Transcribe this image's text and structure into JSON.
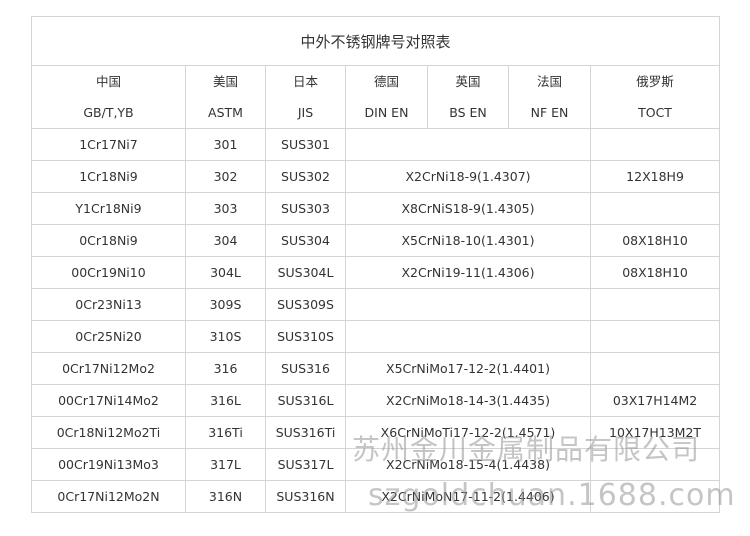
{
  "title": "中外不锈钢牌号对照表",
  "headers": [
    {
      "country": "中国",
      "standard": "GB/T,YB"
    },
    {
      "country": "美国",
      "standard": "ASTM"
    },
    {
      "country": "日本",
      "standard": "JIS"
    },
    {
      "country": "德国",
      "standard": "DIN EN"
    },
    {
      "country": "英国",
      "standard": "BS EN"
    },
    {
      "country": "法国",
      "standard": "NF EN"
    },
    {
      "country": "俄罗斯",
      "standard": "TOCT"
    }
  ],
  "rows": [
    {
      "cn": "1Cr17Ni7",
      "us": "301",
      "jp": "SUS301",
      "eu": "",
      "ru": ""
    },
    {
      "cn": "1Cr18Ni9",
      "us": "302",
      "jp": "SUS302",
      "eu": "X2CrNi18-9(1.4307)",
      "ru": "12X18H9"
    },
    {
      "cn": "Y1Cr18Ni9",
      "us": "303",
      "jp": "SUS303",
      "eu": "X8CrNiS18-9(1.4305)",
      "ru": ""
    },
    {
      "cn": "0Cr18Ni9",
      "us": "304",
      "jp": "SUS304",
      "eu": "X5CrNi18-10(1.4301)",
      "ru": "08X18H10"
    },
    {
      "cn": "00Cr19Ni10",
      "us": "304L",
      "jp": "SUS304L",
      "eu": "X2CrNi19-11(1.4306)",
      "ru": "08X18H10"
    },
    {
      "cn": "0Cr23Ni13",
      "us": "309S",
      "jp": "SUS309S",
      "eu": "",
      "ru": ""
    },
    {
      "cn": "0Cr25Ni20",
      "us": "310S",
      "jp": "SUS310S",
      "eu": "",
      "ru": ""
    },
    {
      "cn": "0Cr17Ni12Mo2",
      "us": "316",
      "jp": "SUS316",
      "eu": "X5CrNiMo17-12-2(1.4401)",
      "ru": ""
    },
    {
      "cn": "00Cr17Ni14Mo2",
      "us": "316L",
      "jp": "SUS316L",
      "eu": "X2CrNiMo18-14-3(1.4435)",
      "ru": "03X17H14M2"
    },
    {
      "cn": "0Cr18Ni12Mo2Ti",
      "us": "316Ti",
      "jp": "SUS316Ti",
      "eu": "X6CrNiMoTi17-12-2(1.4571)",
      "ru": "10X17H13M2T"
    },
    {
      "cn": "00Cr19Ni13Mo3",
      "us": "317L",
      "jp": "SUS317L",
      "eu": "X2CrNiMo18-15-4(1.4438)",
      "ru": ""
    },
    {
      "cn": "0Cr17Ni12Mo2N",
      "us": "316N",
      "jp": "SUS316N",
      "eu": "X2CrNiMoN17-11-2(1.4406)",
      "ru": ""
    }
  ],
  "watermark": {
    "line1": "苏州金川金属制品有限公司",
    "line2": "szgoldchuan.1688.com"
  }
}
